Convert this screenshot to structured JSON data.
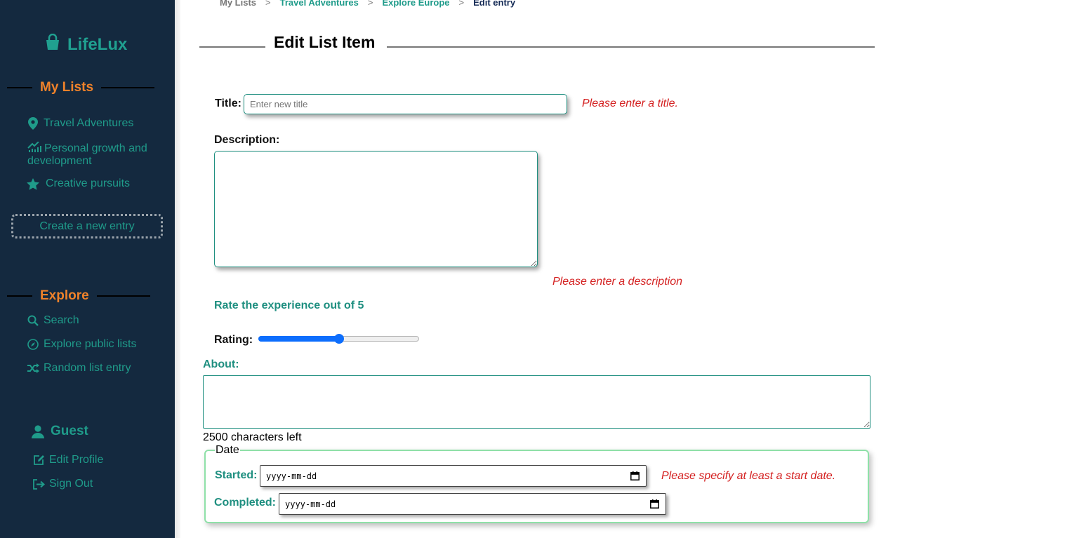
{
  "app": {
    "name": "LifeLux"
  },
  "sidebar": {
    "my_lists_heading": "My Lists",
    "lists": [
      {
        "label": "Travel Adventures",
        "icon": "map-pin-icon"
      },
      {
        "label_line1": "Personal growth and",
        "label_line2": "development",
        "icon": "growth-chart-icon"
      },
      {
        "label": "Creative pursuits",
        "icon": "star-icon"
      }
    ],
    "create_button": "Create a new entry",
    "explore_heading": "Explore",
    "explore": [
      {
        "label": "Search",
        "icon": "search-icon"
      },
      {
        "label": "Explore public lists",
        "icon": "compass-icon"
      },
      {
        "label": "Random list entry",
        "icon": "shuffle-icon"
      }
    ],
    "user": {
      "name": "Guest",
      "icon": "user-icon"
    },
    "account": [
      {
        "label": "Edit Profile",
        "icon": "edit-icon"
      },
      {
        "label": "Sign Out",
        "icon": "sign-out-icon"
      }
    ]
  },
  "breadcrumb": {
    "items": [
      "My Lists",
      "Travel Adventures",
      "Explore Europe",
      "Edit entry"
    ],
    "separator": ">"
  },
  "form": {
    "heading": "Edit List Item",
    "title_label": "Title:",
    "title_placeholder": "Enter new title",
    "title_error": "Please enter a title.",
    "description_label": "Description:",
    "description_error": "Please enter a description",
    "rate_prompt": "Rate the experience out of 5",
    "rating_label": "Rating:",
    "rating_value": 2.5,
    "rating_max": 5,
    "about_label": "About:",
    "chars_left": "2500 characters left",
    "date_legend": "Date",
    "started_label": "Started:",
    "completed_label": "Completed:",
    "date_placeholder": "yyyy-mm-dd",
    "date_error": "Please specify at least a start date."
  },
  "colors": {
    "sidebar_bg": "#14293f",
    "accent_teal": "#1f9b8a",
    "heading_orange": "#f0822a",
    "error_red": "#d42020",
    "slider_blue": "#0d6efd"
  }
}
